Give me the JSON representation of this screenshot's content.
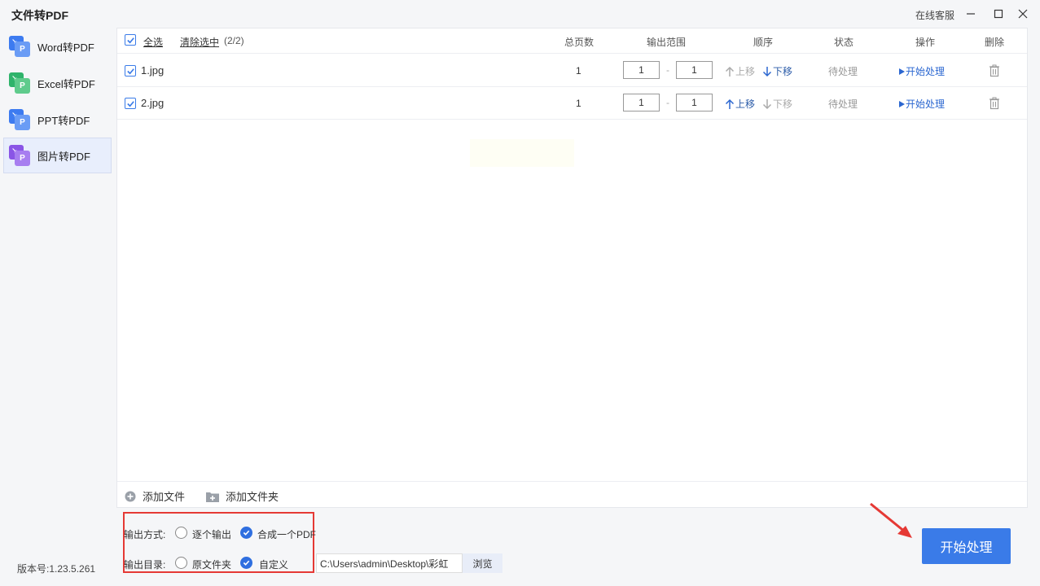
{
  "app": {
    "title": "文件转PDF",
    "support": "在线客服",
    "version": "版本号:1.23.5.261"
  },
  "sidebar": {
    "items": [
      {
        "label": "Word转PDF",
        "icon": "word-pdf-icon",
        "color": "#3d7bf0",
        "active": false
      },
      {
        "label": "Excel转PDF",
        "icon": "excel-pdf-icon",
        "color": "#2fb36b",
        "active": false
      },
      {
        "label": "PPT转PDF",
        "icon": "ppt-pdf-icon",
        "color": "#3d7bf0",
        "active": false
      },
      {
        "label": "图片转PDF",
        "icon": "image-pdf-icon",
        "color": "#8a55e6",
        "active": true
      }
    ]
  },
  "table": {
    "select_all": "全选",
    "clear_selection": "清除选中",
    "selection_count": "(2/2)",
    "columns": {
      "pages": "总页数",
      "range": "输出范围",
      "order": "顺序",
      "status": "状态",
      "action": "操作",
      "delete": "删除"
    },
    "rows": [
      {
        "name": "1.jpg",
        "pages": "1",
        "range_from": "1",
        "range_to": "1",
        "up": "上移",
        "down": "下移",
        "status": "待处理",
        "action": "开始处理"
      },
      {
        "name": "2.jpg",
        "pages": "1",
        "range_from": "1",
        "range_to": "1",
        "up": "上移",
        "down": "下移",
        "status": "待处理",
        "action": "开始处理"
      }
    ],
    "range_sep": "-"
  },
  "footer": {
    "add_file": "添加文件",
    "add_folder": "添加文件夹"
  },
  "output": {
    "mode_label": "输出方式:",
    "mode_options": [
      "逐个输出",
      "合成一个PDF"
    ],
    "mode_selected": "合成一个PDF",
    "dir_label": "输出目录:",
    "dir_options": [
      "原文件夹",
      "自定义"
    ],
    "dir_selected": "自定义",
    "path": "C:\\Users\\admin\\Desktop\\彩虹",
    "browse": "浏览"
  },
  "start_button": "开始处理",
  "colors": {
    "accent": "#3a7be8",
    "highlight_box": "#e53935"
  }
}
